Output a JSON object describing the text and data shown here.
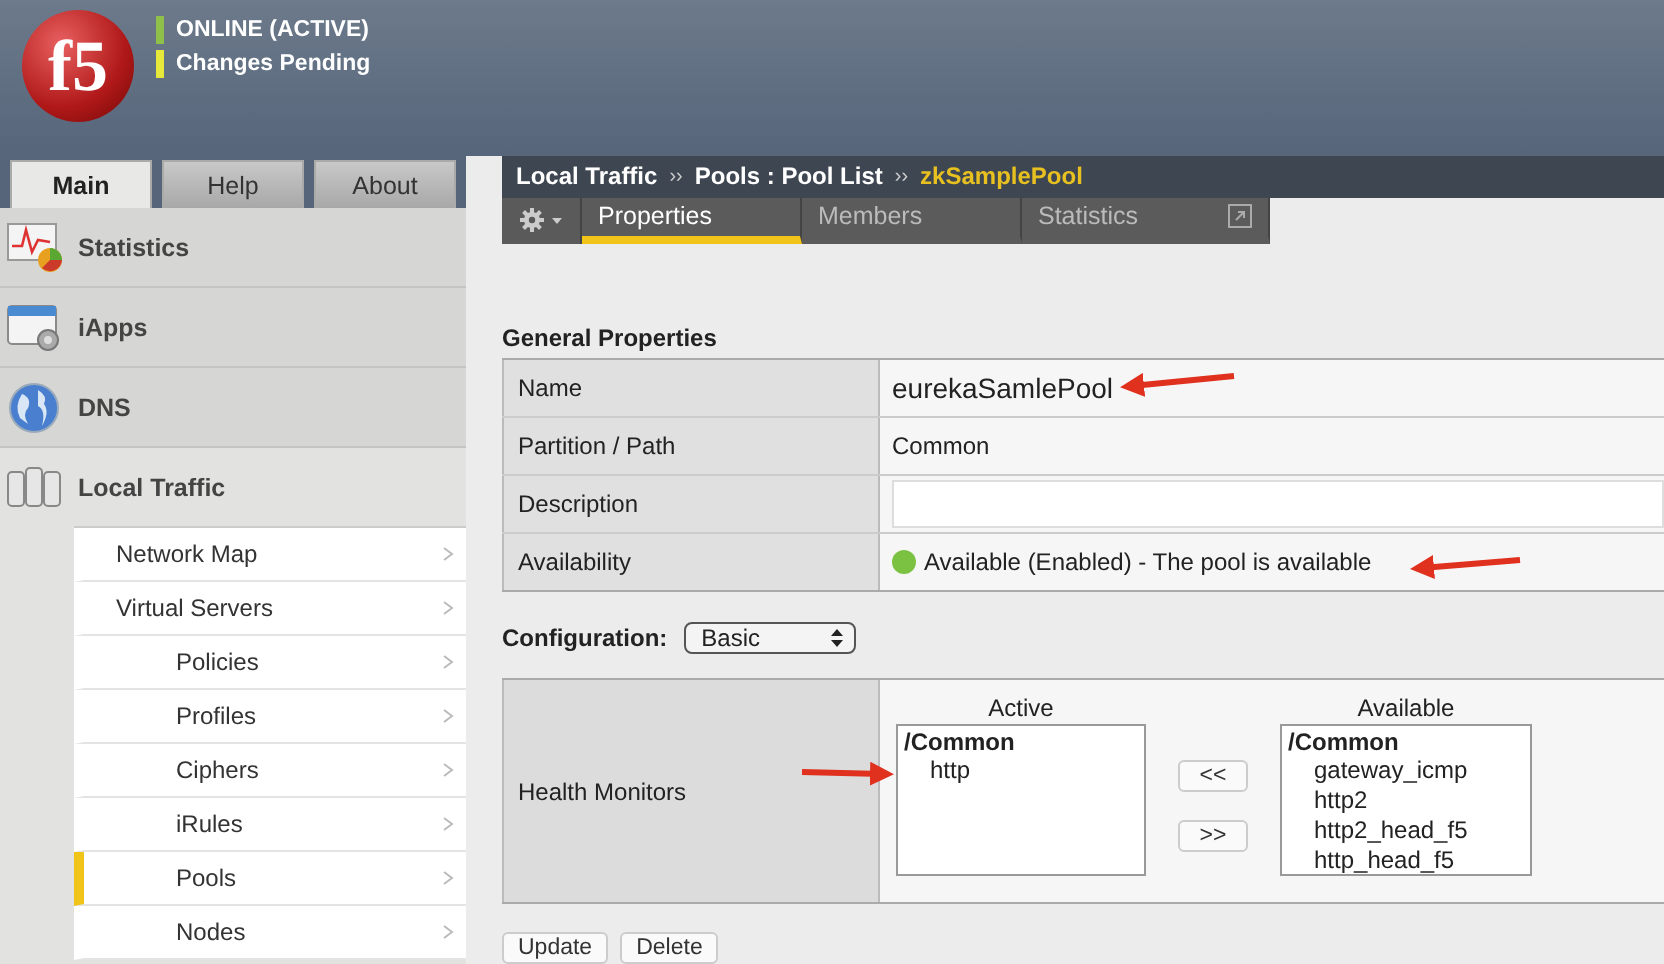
{
  "header": {
    "logo_text": "f5",
    "status": [
      {
        "text": "ONLINE (ACTIVE)",
        "color": "#8fc04a"
      },
      {
        "text": "Changes Pending",
        "color": "#e8e83a"
      }
    ]
  },
  "nav_tabs": [
    {
      "label": "Main",
      "selected": true
    },
    {
      "label": "Help",
      "selected": false
    },
    {
      "label": "About",
      "selected": false
    }
  ],
  "sidebar": {
    "sections": [
      {
        "label": "Statistics"
      },
      {
        "label": "iApps"
      },
      {
        "label": "DNS"
      },
      {
        "label": "Local Traffic",
        "children": [
          {
            "label": "Network Map",
            "selected": false
          },
          {
            "label": "Virtual Servers",
            "selected": false,
            "children": [
              {
                "label": "Policies",
                "selected": false
              },
              {
                "label": "Profiles",
                "selected": false
              },
              {
                "label": "Ciphers",
                "selected": false
              },
              {
                "label": "iRules",
                "selected": false
              },
              {
                "label": "Pools",
                "selected": true
              },
              {
                "label": "Nodes",
                "selected": false
              }
            ]
          }
        ]
      }
    ]
  },
  "breadcrumb": [
    {
      "kind": "crumb",
      "text": "Local Traffic"
    },
    {
      "kind": "separator",
      "text": "››"
    },
    {
      "kind": "crumb",
      "text": "Pools : Pool List"
    },
    {
      "kind": "separator",
      "text": "››"
    },
    {
      "kind": "current",
      "text": "zkSamplePool"
    }
  ],
  "subtabs": [
    {
      "label": "Properties",
      "selected": true
    },
    {
      "label": "Members",
      "selected": false
    },
    {
      "label": "Statistics",
      "selected": false
    }
  ],
  "general_properties": {
    "title": "General Properties",
    "rows": [
      {
        "kind": "text",
        "label": "Name",
        "value": "eurekaSamlePool"
      },
      {
        "kind": "text",
        "label": "Partition / Path",
        "value": "Common"
      },
      {
        "kind": "input",
        "label": "Description"
      },
      {
        "kind": "status",
        "label": "Availability",
        "value": "Available (Enabled) - The pool is available",
        "color": "#7cc242"
      }
    ]
  },
  "configuration": {
    "label": "Configuration:",
    "value": "Basic"
  },
  "health_monitors": {
    "label": "Health Monitors",
    "active": {
      "heading": "Active",
      "group": "/Common",
      "items": [
        "http"
      ]
    },
    "available": {
      "heading": "Available",
      "group": "/Common",
      "items": [
        "gateway_icmp",
        "http2",
        "http2_head_f5",
        "http_head_f5"
      ]
    },
    "move_buttons": [
      "<<",
      ">>"
    ]
  },
  "actions": [
    "Update",
    "Delete"
  ]
}
